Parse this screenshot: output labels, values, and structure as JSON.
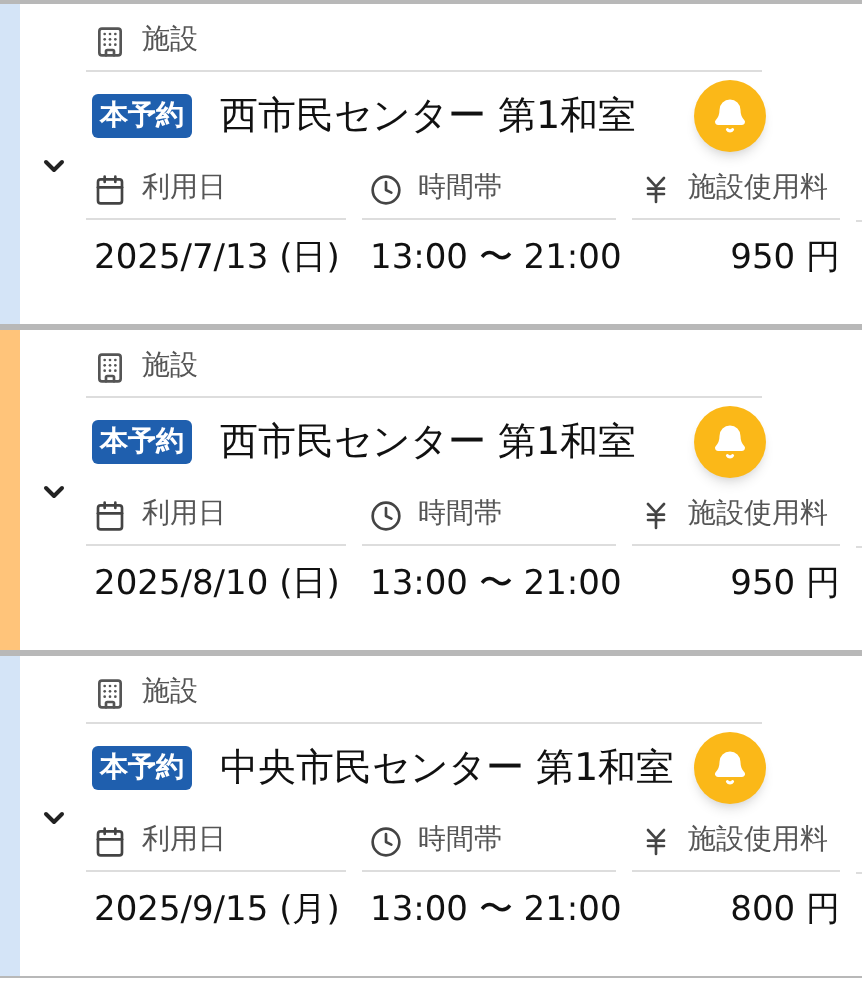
{
  "reservations": [
    {
      "color": "#d4e4f7",
      "facility_label": "施設",
      "badge": "本予約",
      "facility": "西市民センター 第1和室",
      "date_label": "利用日",
      "time_label": "時間帯",
      "fee_label": "施設使用料",
      "date": "2025/7/13 (日)",
      "time": "13:00 〜 21:00",
      "fee": "950 円"
    },
    {
      "color": "#ffc47a",
      "facility_label": "施設",
      "badge": "本予約",
      "facility": "西市民センター 第1和室",
      "date_label": "利用日",
      "time_label": "時間帯",
      "fee_label": "施設使用料",
      "date": "2025/8/10 (日)",
      "time": "13:00 〜 21:00",
      "fee": "950 円"
    },
    {
      "color": "#d4e4f7",
      "facility_label": "施設",
      "badge": "本予約",
      "facility": "中央市民センター 第1和室",
      "date_label": "利用日",
      "time_label": "時間帯",
      "fee_label": "施設使用料",
      "date": "2025/9/15 (月)",
      "time": "13:00 〜 21:00",
      "fee": "800 円"
    }
  ]
}
